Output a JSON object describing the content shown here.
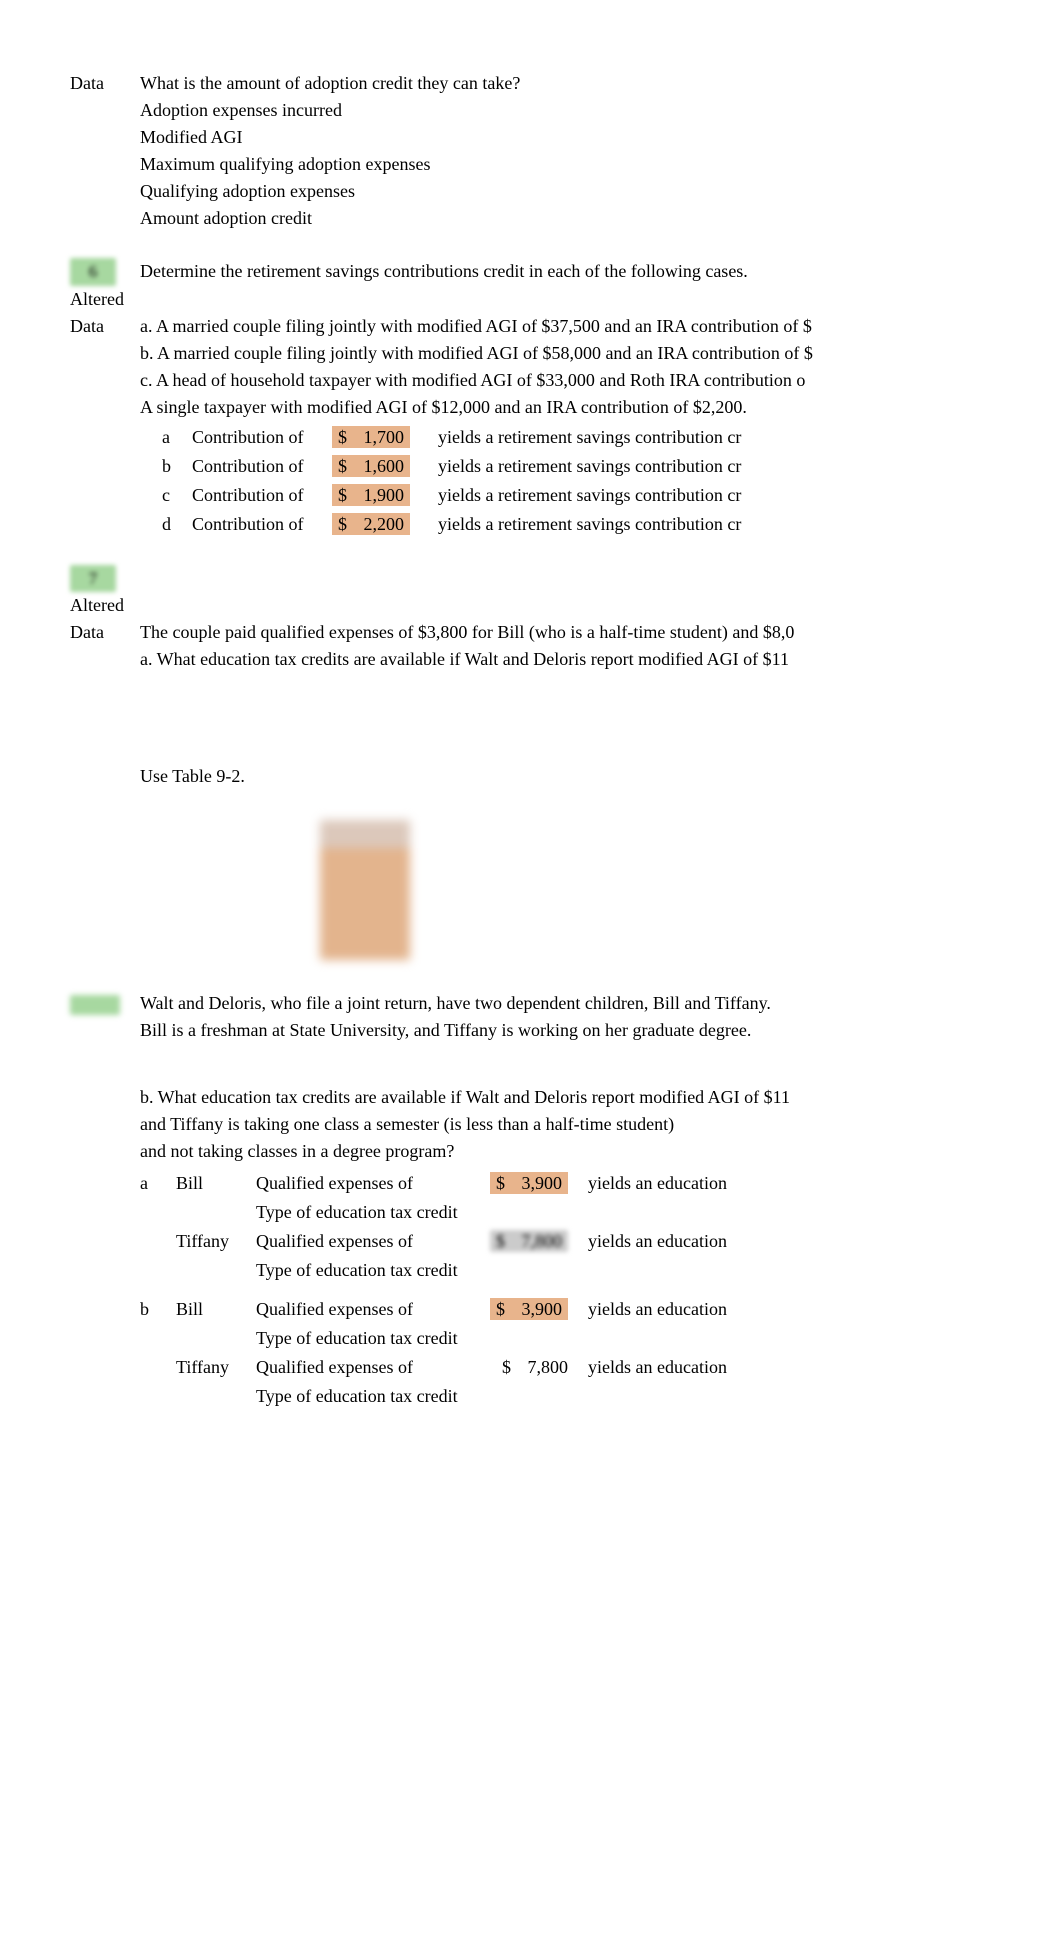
{
  "data_label": "Data",
  "altered_label": "Altered",
  "q5": {
    "q": "What is the amount of adoption credit they can take?",
    "lines": [
      "Adoption expenses incurred",
      "Modified AGI",
      "Maximum qualifying adoption expenses",
      "Qualifying adoption expenses",
      "Amount adoption credit"
    ]
  },
  "q6": {
    "num": "6",
    "q": "Determine the retirement savings contributions credit in each of the following cases.",
    "cases": [
      "a. A married couple filing jointly with modified AGI of $37,500 and an IRA contribution of $",
      "b. A married couple filing jointly with modified AGI of $58,000 and an IRA contribution of $",
      "c. A head of household taxpayer with modified AGI of $33,000 and Roth IRA contribution o",
      "A single taxpayer with modified AGI of $12,000 and an IRA contribution of $2,200."
    ],
    "rows": [
      {
        "l": "a",
        "t": "Contribution of",
        "a": "1,700",
        "y": "yields a retirement savings contribution cr"
      },
      {
        "l": "b",
        "t": "Contribution of",
        "a": "1,600",
        "y": "yields a retirement savings contribution cr"
      },
      {
        "l": "c",
        "t": "Contribution of",
        "a": "1,900",
        "y": "yields a retirement savings contribution cr"
      },
      {
        "l": "d",
        "t": "Contribution of",
        "a": "2,200",
        "y": "yields a retirement savings contribution cr"
      }
    ]
  },
  "q7": {
    "num": "7",
    "p1": "The couple paid qualified expenses of $3,800 for Bill (who is a half-time student) and $8,0",
    "p1b": "a. What education tax credits are available if Walt and Deloris report modified AGI of $11",
    "table_ref": "Use Table 9-2.",
    "context1": "Walt and Deloris, who file a joint return, have two dependent children, Bill and Tiffany.",
    "context2": "Bill is a freshman at State University, and Tiffany is working on her graduate degree.",
    "pb1": "b. What education tax credits are available if Walt and Deloris report modified AGI of $11",
    "pb2": "and Tiffany is taking one class a semester (is less than a half-time student)",
    "pb3": "and not taking classes in a degree program?",
    "edu": [
      {
        "l": "a",
        "n": "Bill",
        "d": "Qualified expenses of",
        "a": "3,900",
        "bg": true,
        "y": "yields an education"
      },
      {
        "l": "",
        "n": "",
        "d": "Type of education tax credit",
        "a": "",
        "bg": false,
        "y": ""
      },
      {
        "l": "",
        "n": "Tiffany",
        "d": "Qualified expenses of",
        "a": "7,800",
        "bg": false,
        "blur": true,
        "y": "yields an education"
      },
      {
        "l": "",
        "n": "",
        "d": "Type of education tax credit",
        "a": "",
        "bg": false,
        "y": ""
      },
      {
        "gap": true
      },
      {
        "l": "b",
        "n": "Bill",
        "d": "Qualified expenses of",
        "a": "3,900",
        "bg": true,
        "y": "yields an education"
      },
      {
        "l": "",
        "n": "",
        "d": "Type of education tax credit",
        "a": "",
        "bg": false,
        "y": ""
      },
      {
        "l": "",
        "n": "Tiffany",
        "d": "Qualified expenses of",
        "a": "7,800",
        "bg": false,
        "y": "yields an education"
      },
      {
        "l": "",
        "n": "",
        "d": "Type of education tax credit",
        "a": "",
        "bg": false,
        "y": ""
      }
    ]
  },
  "dollar": "$"
}
